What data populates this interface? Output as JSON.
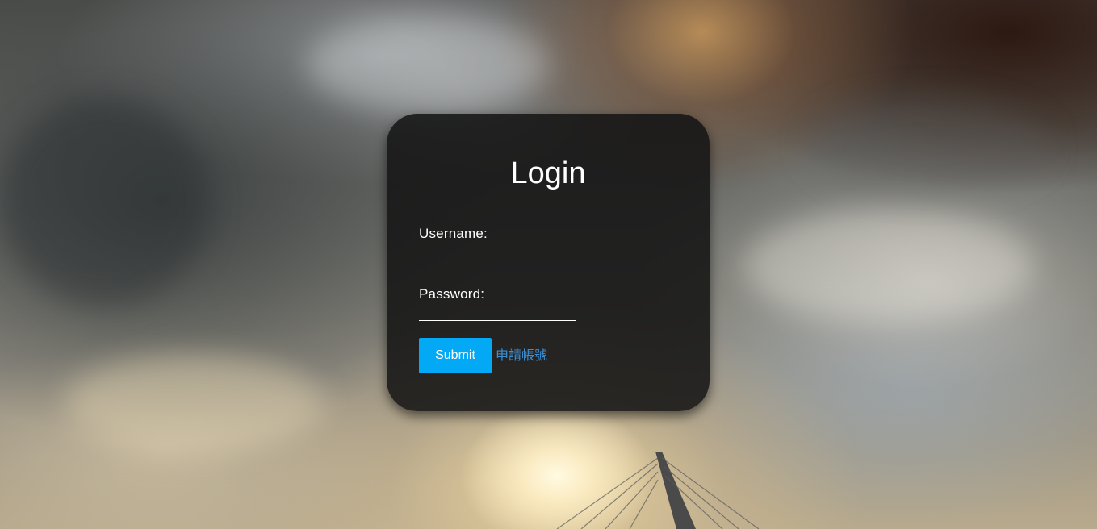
{
  "login": {
    "title": "Login",
    "username_label": "Username:",
    "username_value": "",
    "password_label": "Password:",
    "password_value": "",
    "submit_label": "Submit",
    "register_link": "申請帳號"
  },
  "colors": {
    "submit_button": "#03a9f4",
    "register_link": "#3a8fd6",
    "card_background": "rgba(20,20,20,0.88)"
  }
}
